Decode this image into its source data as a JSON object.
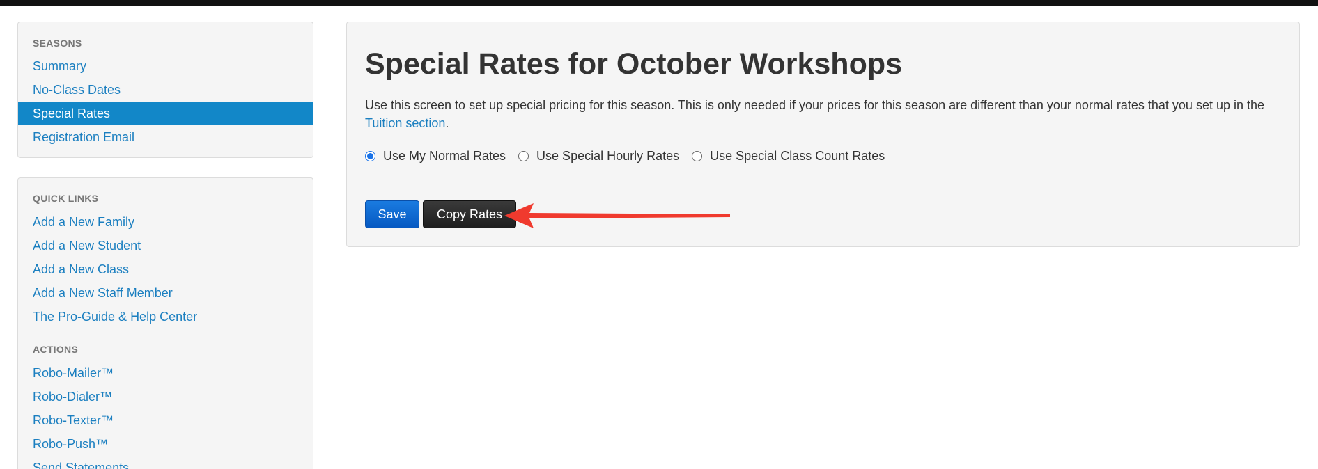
{
  "sidebar": {
    "seasons": {
      "title": "SEASONS",
      "items": [
        {
          "label": "Summary"
        },
        {
          "label": "No-Class Dates"
        },
        {
          "label": "Special Rates"
        },
        {
          "label": "Registration Email"
        }
      ]
    },
    "quick_links": {
      "title": "QUICK LINKS",
      "items": [
        {
          "label": "Add a New Family"
        },
        {
          "label": "Add a New Student"
        },
        {
          "label": "Add a New Class"
        },
        {
          "label": "Add a New Staff Member"
        },
        {
          "label": "The Pro-Guide & Help Center"
        }
      ]
    },
    "actions": {
      "title": "ACTIONS",
      "items": [
        {
          "label": "Robo-Mailer™"
        },
        {
          "label": "Robo-Dialer™"
        },
        {
          "label": "Robo-Texter™"
        },
        {
          "label": "Robo-Push™"
        },
        {
          "label": "Send Statements"
        }
      ]
    }
  },
  "main": {
    "title": "Special Rates for October Workshops",
    "description_prefix": "Use this screen to set up special pricing for this season. This is only needed if your prices for this season are different than your normal rates that you set up in the ",
    "description_link": "Tuition section",
    "description_suffix": ".",
    "rate_options": [
      {
        "label": "Use My Normal Rates",
        "checked": true
      },
      {
        "label": "Use Special Hourly Rates",
        "checked": false
      },
      {
        "label": "Use Special Class Count Rates",
        "checked": false
      }
    ],
    "save_label": "Save",
    "copy_label": "Copy Rates"
  },
  "colors": {
    "link": "#1b7fc0",
    "active_nav": "#1287c8",
    "save_button": "#0a63d0",
    "copy_button": "#2b2b2b",
    "annotation_arrow": "#f03a2e"
  }
}
